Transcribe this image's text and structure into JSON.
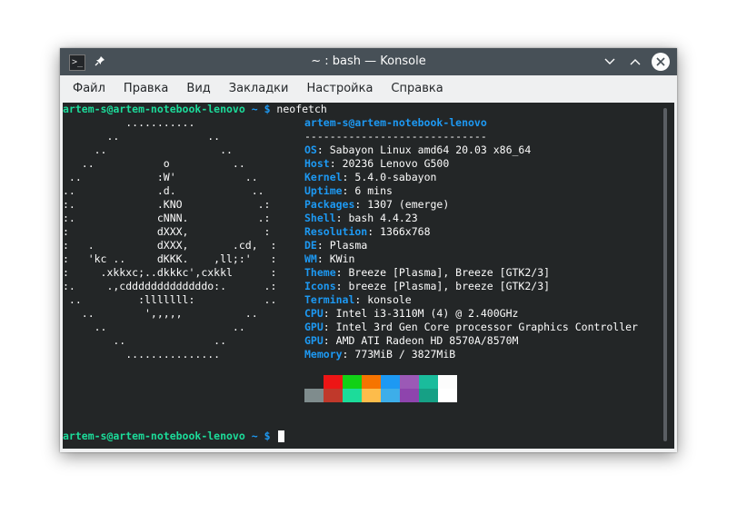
{
  "window": {
    "title": "~ : bash — Konsole"
  },
  "menubar": {
    "items": [
      "Файл",
      "Правка",
      "Вид",
      "Закладки",
      "Настройка",
      "Справка"
    ]
  },
  "terminal": {
    "prompt_user": "artem-s@artem-notebook-lenovo",
    "prompt_path": " ~ $ ",
    "command": "neofetch",
    "logo_lines": [
      "          ...........",
      "       ..              ..",
      "     ..                  ..",
      "   ..           o          ..",
      " ..            :W'           ..",
      "..             .d.            ..",
      ":.             .KNO            .:",
      ":.             cNNN.           .:",
      ":              dXXX,            :",
      ":   .          dXXX,       .cd,  :",
      ":   'kc ..     dKKK.    ,ll;:'   :",
      ":     .xkkxc;..dkkkc',cxkkl      :",
      ":.     .,cdddddddddddddo:.      .:",
      " ..         :lllllll:           ..",
      "   ..        ',,,,,          ..",
      "     ..                    ..",
      "        ..              ..",
      "          ..............."
    ],
    "info_user": "artem-s@artem-notebook-lenovo",
    "info_sep": "-----------------------------",
    "info": [
      {
        "key": "OS",
        "value": "Sabayon Linux amd64 20.03 x86_64"
      },
      {
        "key": "Host",
        "value": "20236 Lenovo G500"
      },
      {
        "key": "Kernel",
        "value": "5.4.0-sabayon"
      },
      {
        "key": "Uptime",
        "value": "6 mins"
      },
      {
        "key": "Packages",
        "value": "1307 (emerge)"
      },
      {
        "key": "Shell",
        "value": "bash 4.4.23"
      },
      {
        "key": "Resolution",
        "value": "1366x768"
      },
      {
        "key": "DE",
        "value": "Plasma"
      },
      {
        "key": "WM",
        "value": "KWin"
      },
      {
        "key": "Theme",
        "value": "Breeze [Plasma], Breeze [GTK2/3]"
      },
      {
        "key": "Icons",
        "value": "breeze [Plasma], breeze [GTK2/3]"
      },
      {
        "key": "Terminal",
        "value": "konsole"
      },
      {
        "key": "CPU",
        "value": "Intel i3-3110M (4) @ 2.400GHz"
      },
      {
        "key": "GPU",
        "value": "Intel 3rd Gen Core processor Graphics Controller"
      },
      {
        "key": "GPU",
        "value": "AMD ATI Radeon HD 8570A/8570M"
      },
      {
        "key": "Memory",
        "value": "773MiB / 3827MiB"
      }
    ],
    "palette_top": [
      "#232627",
      "#ed1515",
      "#11d116",
      "#f67400",
      "#1d99f3",
      "#9b59b6",
      "#1abc9c",
      "#fcfcfc"
    ],
    "palette_bottom": [
      "#7f8c8d",
      "#c0392b",
      "#1cdc9a",
      "#fdbc4b",
      "#3daee9",
      "#8e44ad",
      "#16a085",
      "#ffffff"
    ]
  },
  "icons": {
    "terminal": "terminal-icon",
    "pin": "pin-icon",
    "minimize": "chevron-down-icon",
    "maximize": "chevron-up-icon",
    "close": "close-icon"
  }
}
